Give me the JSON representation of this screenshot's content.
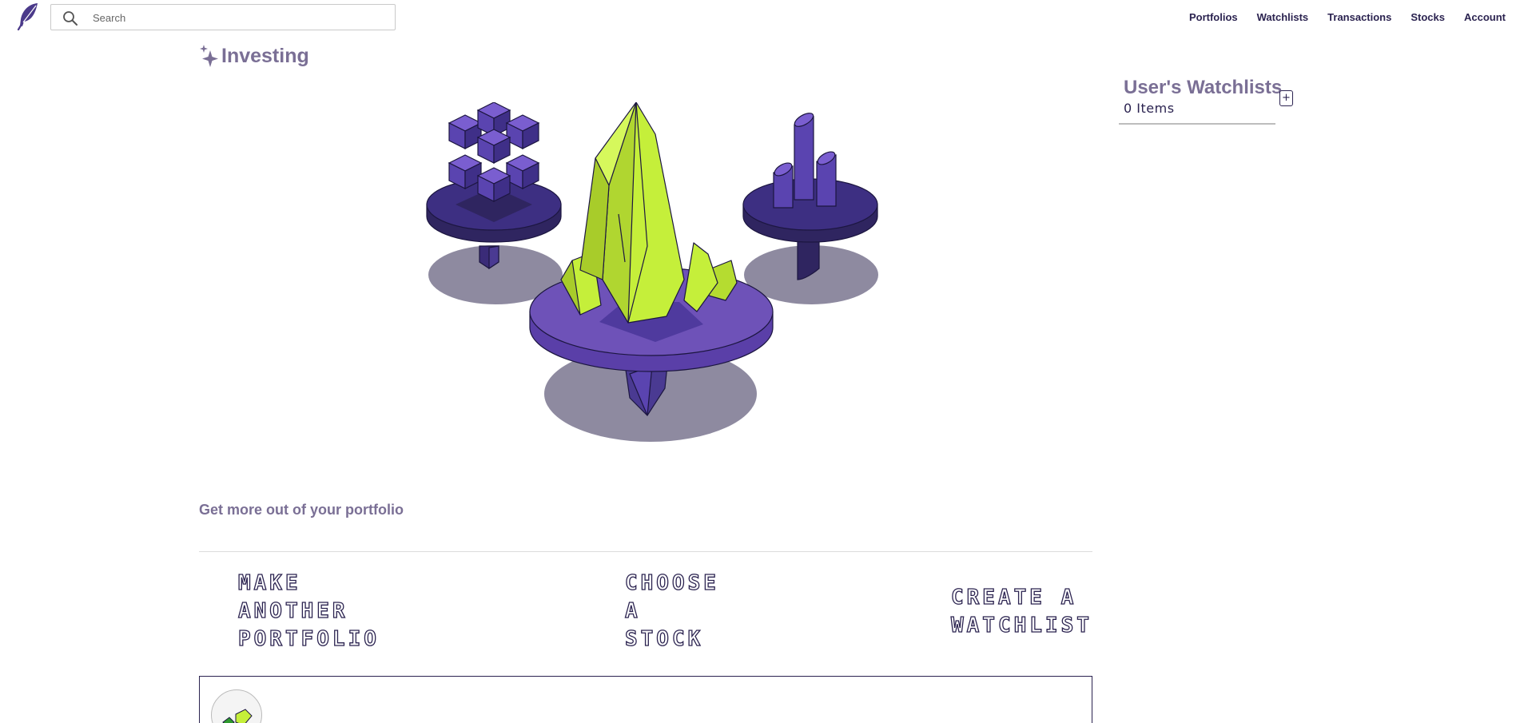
{
  "colors": {
    "brand_purple": "#2b2350",
    "heading_purple": "#7a6f95",
    "platform_purple": "#6a4fb3",
    "crystal_lime": "#c5ef3a"
  },
  "header": {
    "logo_icon": "feather-icon",
    "search": {
      "placeholder": "Search",
      "icon": "search-icon"
    },
    "nav": [
      {
        "label": "Portfolios"
      },
      {
        "label": "Watchlists"
      },
      {
        "label": "Transactions"
      },
      {
        "label": "Stocks"
      },
      {
        "label": "Account"
      }
    ]
  },
  "main": {
    "title": "Investing",
    "title_icon": "sparkle-icon",
    "hero_icon": "crystal-platforms-illustration",
    "section_title": "Get more out of your portfolio",
    "actions": [
      {
        "lines": [
          "Make",
          "Another",
          "Portfolio"
        ]
      },
      {
        "lines": [
          "Choose",
          "A",
          "Stock"
        ]
      },
      {
        "lines": [
          "Create A",
          "Watchlist"
        ]
      }
    ]
  },
  "watchlists": {
    "title": "User's Watchlists",
    "count": "0 Items",
    "add_label": "+"
  }
}
